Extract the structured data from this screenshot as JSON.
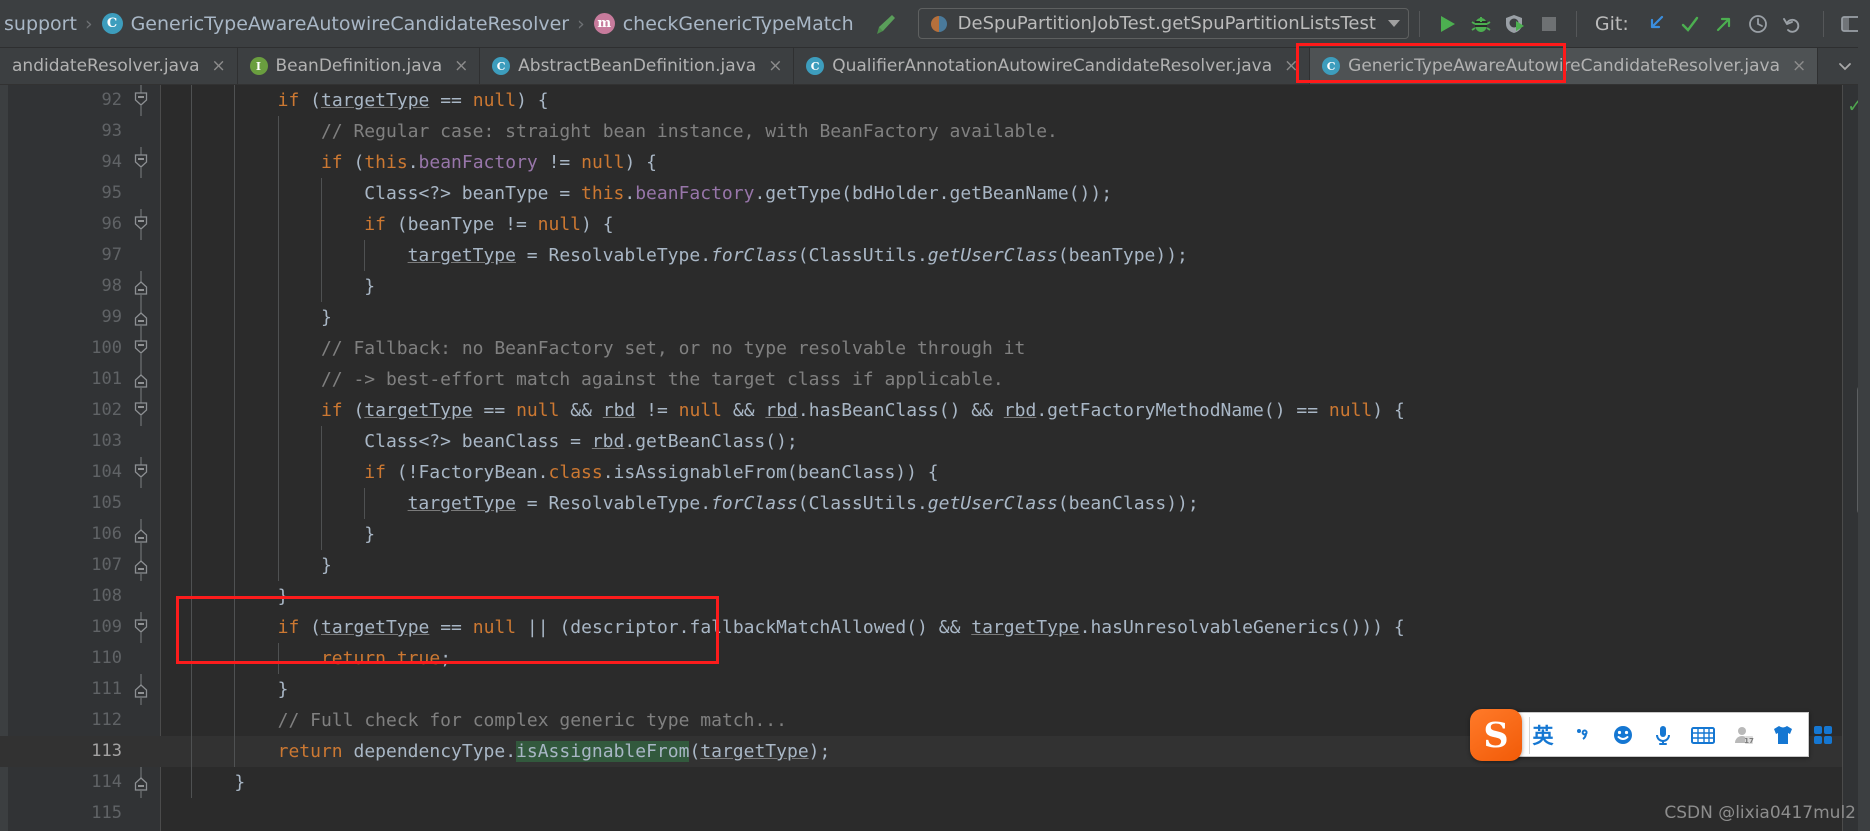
{
  "window": {
    "theme": "darcula",
    "accent_red": "#fc1c1c",
    "bg": "#2b2b2b"
  },
  "toolbar": {
    "breadcrumb": [
      {
        "label": "support",
        "icon": ""
      },
      {
        "label": "GenericTypeAwareAutowireCandidateResolver",
        "icon": "class-icon",
        "icon_letter": "C"
      },
      {
        "label": "checkGenericTypeMatch",
        "icon": "method-icon",
        "icon_letter": "m"
      }
    ],
    "separator": "›",
    "build_icon": "hammer-icon",
    "run_config": {
      "icon": "run-config-icon",
      "label": "DeSpuPartitionJobTest.getSpuPartitionListsTest",
      "dropdown_icon": "chevron-down-icon"
    },
    "actions": [
      {
        "name": "run-button",
        "icon": "play-icon"
      },
      {
        "name": "debug-button",
        "icon": "bug-icon"
      },
      {
        "name": "run-with-coverage-button",
        "icon": "coverage-icon"
      },
      {
        "name": "stop-button",
        "icon": "stop-icon"
      }
    ],
    "git_label": "Git:",
    "git_actions": [
      {
        "name": "git-update-button",
        "icon": "arrow-down-left-icon"
      },
      {
        "name": "git-commit-button",
        "icon": "check-icon"
      },
      {
        "name": "git-push-button",
        "icon": "arrow-up-right-icon"
      },
      {
        "name": "git-history-button",
        "icon": "clock-icon"
      },
      {
        "name": "git-rollback-button",
        "icon": "undo-icon"
      }
    ],
    "right_actions": [
      {
        "name": "search-everywhere-button",
        "icon": "magnifier-icon"
      },
      {
        "name": "layout-button",
        "icon": "window-icon"
      }
    ]
  },
  "tabs": {
    "items": [
      {
        "label": "andidateResolver.java",
        "icon": "class-icon",
        "icon_letter": "C",
        "active": false,
        "truncated": true
      },
      {
        "label": "BeanDefinition.java",
        "icon": "interface-icon",
        "icon_letter": "I",
        "active": false
      },
      {
        "label": "AbstractBeanDefinition.java",
        "icon": "abstract-class-icon",
        "icon_letter": "C",
        "active": false
      },
      {
        "label": "QualifierAnnotationAutowireCandidateResolver.java",
        "icon": "class-icon",
        "icon_letter": "C",
        "active": false
      },
      {
        "label": "GenericTypeAwareAutowireCandidateResolver.java",
        "icon": "class-icon",
        "icon_letter": "C",
        "active": true,
        "highlighted": true
      }
    ],
    "close_glyph": "×",
    "overflow_glyph": "⌄"
  },
  "editor": {
    "first_line": 92,
    "current_line": 113,
    "inspection_status": "✓",
    "lines": [
      {
        "n": 92,
        "fold": "collapse",
        "indent": 2,
        "html": "<span class=\"kw\">if</span> (<span class=\"und\">targetType</span> == <span class=\"kw\">null</span>) {"
      },
      {
        "n": 93,
        "fold": "",
        "indent": 3,
        "html": "<span class=\"cmt\">// Regular case: straight bean instance, with BeanFactory available.</span>"
      },
      {
        "n": 94,
        "fold": "collapse",
        "indent": 3,
        "html": "<span class=\"kw\">if</span> (<span class=\"kw\">this</span>.<span class=\"fld\">beanFactory</span> != <span class=\"kw\">null</span>) {"
      },
      {
        "n": 95,
        "fold": "",
        "indent": 4,
        "html": "Class&lt;?&gt; beanType = <span class=\"kw\">this</span>.<span class=\"fld\">beanFactory</span>.getType(bdHolder.getBeanName());"
      },
      {
        "n": 96,
        "fold": "collapse",
        "indent": 4,
        "html": "<span class=\"kw\">if</span> (beanType != <span class=\"kw\">null</span>) {"
      },
      {
        "n": 97,
        "fold": "",
        "indent": 5,
        "html": "<span class=\"und\">targetType</span> = ResolvableType.<span class=\"stat\">forClass</span>(ClassUtils.<span class=\"stat\">getUserClass</span>(beanType));"
      },
      {
        "n": 98,
        "fold": "expand",
        "indent": 4,
        "html": "}"
      },
      {
        "n": 99,
        "fold": "expand",
        "indent": 3,
        "html": "}"
      },
      {
        "n": 100,
        "fold": "collapse",
        "indent": 3,
        "html": "<span class=\"cmt\">// Fallback: no BeanFactory set, or no type resolvable through it</span>"
      },
      {
        "n": 101,
        "fold": "expand",
        "indent": 3,
        "html": "<span class=\"cmt\">// -&gt; best-effort match against the target class if applicable.</span>"
      },
      {
        "n": 102,
        "fold": "collapse",
        "indent": 3,
        "html": "<span class=\"kw\">if</span> (<span class=\"und\">targetType</span> == <span class=\"kw\">null</span> &amp;&amp; <span class=\"und\">rbd</span> != <span class=\"kw\">null</span> &amp;&amp; <span class=\"und\">rbd</span>.hasBeanClass() &amp;&amp; <span class=\"und\">rbd</span>.getFactoryMethodName() == <span class=\"kw\">null</span>) {"
      },
      {
        "n": 103,
        "fold": "",
        "indent": 4,
        "html": "Class&lt;?&gt; beanClass = <span class=\"und\">rbd</span>.getBeanClass();"
      },
      {
        "n": 104,
        "fold": "collapse",
        "indent": 4,
        "html": "<span class=\"kw\">if</span> (!FactoryBean.<span class=\"kw\">class</span>.isAssignableFrom(beanClass)) {"
      },
      {
        "n": 105,
        "fold": "",
        "indent": 5,
        "html": "<span class=\"und\">targetType</span> = ResolvableType.<span class=\"stat\">forClass</span>(ClassUtils.<span class=\"stat\">getUserClass</span>(beanClass));"
      },
      {
        "n": 106,
        "fold": "expand",
        "indent": 4,
        "html": "}"
      },
      {
        "n": 107,
        "fold": "expand",
        "indent": 3,
        "html": "}"
      },
      {
        "n": 108,
        "fold": "",
        "indent": 2,
        "html": "}"
      },
      {
        "n": 109,
        "fold": "collapse",
        "indent": 2,
        "html": "<span class=\"kw\">if</span> (<span class=\"und\">targetType</span> == <span class=\"kw\">null</span> || (descriptor.fallbackMatchAllowed() &amp;&amp; <span class=\"und\">targetType</span>.hasUnresolvableGenerics())) {"
      },
      {
        "n": 110,
        "fold": "",
        "indent": 3,
        "html": "<span class=\"kw\">return</span> <span class=\"kw\">true</span>;"
      },
      {
        "n": 111,
        "fold": "expand",
        "indent": 2,
        "html": "}"
      },
      {
        "n": 112,
        "fold": "",
        "indent": 2,
        "html": "<span class=\"cmt\">// Full check for complex generic type match...</span>"
      },
      {
        "n": 113,
        "fold": "",
        "indent": 2,
        "html": "<span class=\"kw\">return</span> dependencyType.<span class=\"hl\">isAssignableFrom</span>(<span class=\"und\">targetType</span>);"
      },
      {
        "n": 114,
        "fold": "expand",
        "indent": 1,
        "html": "}"
      },
      {
        "n": 115,
        "fold": "",
        "indent": 0,
        "html": ""
      }
    ]
  },
  "annotations": [
    {
      "name": "tab-highlight-box",
      "target": "active tab GenericTypeAwareAutowireCandidateResolver.java",
      "color": "#fc1c1c"
    },
    {
      "name": "code-highlight-box",
      "target": "lines 112-113 return statement",
      "color": "#fc1c1c"
    }
  ],
  "ime": {
    "logo_letter": "S",
    "items": [
      {
        "name": "ime-language-toggle",
        "glyph": "英"
      },
      {
        "name": "ime-punctuation-toggle",
        "glyph": "‧,"
      },
      {
        "name": "ime-emoji-button",
        "glyph": "☺"
      },
      {
        "name": "ime-voice-button",
        "glyph": "Ἲ4"
      },
      {
        "name": "ime-keyboard-button",
        "glyph": "⌨"
      },
      {
        "name": "ime-user-button",
        "glyph": "὆4"
      },
      {
        "name": "ime-skin-button",
        "glyph": "ὅ5"
      },
      {
        "name": "ime-toolbox-button",
        "glyph": "∷"
      }
    ]
  },
  "watermark": {
    "text": "CSDN @lixia0417mul2"
  }
}
